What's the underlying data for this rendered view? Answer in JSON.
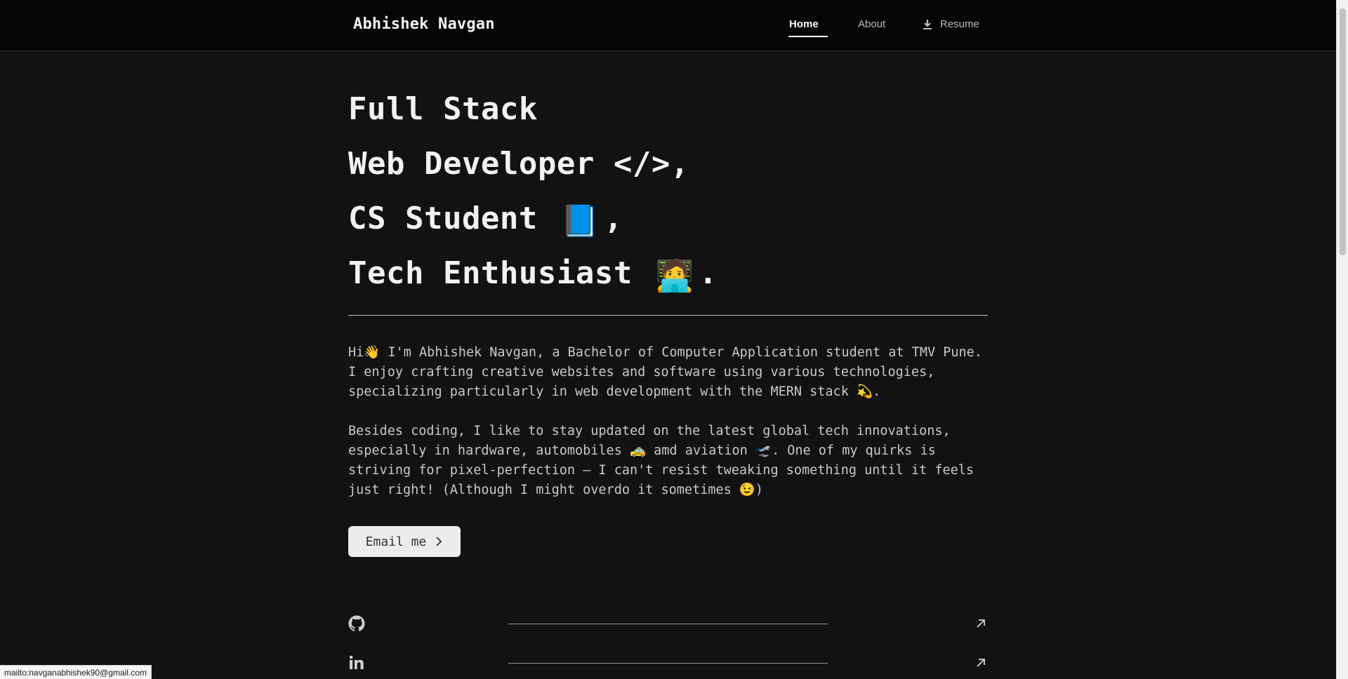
{
  "nav": {
    "brand": "Abhishek Navgan",
    "links": [
      {
        "label": "Home",
        "active": true
      },
      {
        "label": "About",
        "active": false
      },
      {
        "label": "Resume",
        "icon": "download-icon"
      }
    ]
  },
  "hero": {
    "lines": [
      "Full Stack",
      "Web Developer </>,",
      "CS Student",
      "Tech Enthusiast"
    ],
    "line3_emoji": "📘",
    "line3_suffix": ",",
    "line4_emoji": "🧑‍💻",
    "line4_suffix": "."
  },
  "about": {
    "paragraph1": "Hi👋 I'm Abhishek Navgan, a Bachelor of Computer Application student at TMV Pune. I enjoy crafting creative websites and software using various technologies, specializing particularly in web development with the MERN stack 💫.",
    "paragraph2": "Besides coding, I like to stay updated on the latest global tech innovations, especially in hardware, automobiles 🚕 amd aviation 🛫. One of my quirks is striving for pixel-perfection — I can't resist tweaking something until it feels just right! (Although I might overdo it sometimes 😉)"
  },
  "cta": {
    "email_label": "Email me"
  },
  "social": [
    {
      "icon": "github-icon",
      "arrow": "external-link-arrow-icon"
    },
    {
      "icon": "linkedin-icon",
      "arrow": "external-link-arrow-icon"
    }
  ],
  "status": {
    "url": "mailto:navganabhishek90@gmail.com"
  },
  "colors": {
    "background": "#121212",
    "navbar": "#050505",
    "text": "#f2f2f2",
    "button_bg": "#ececec"
  }
}
